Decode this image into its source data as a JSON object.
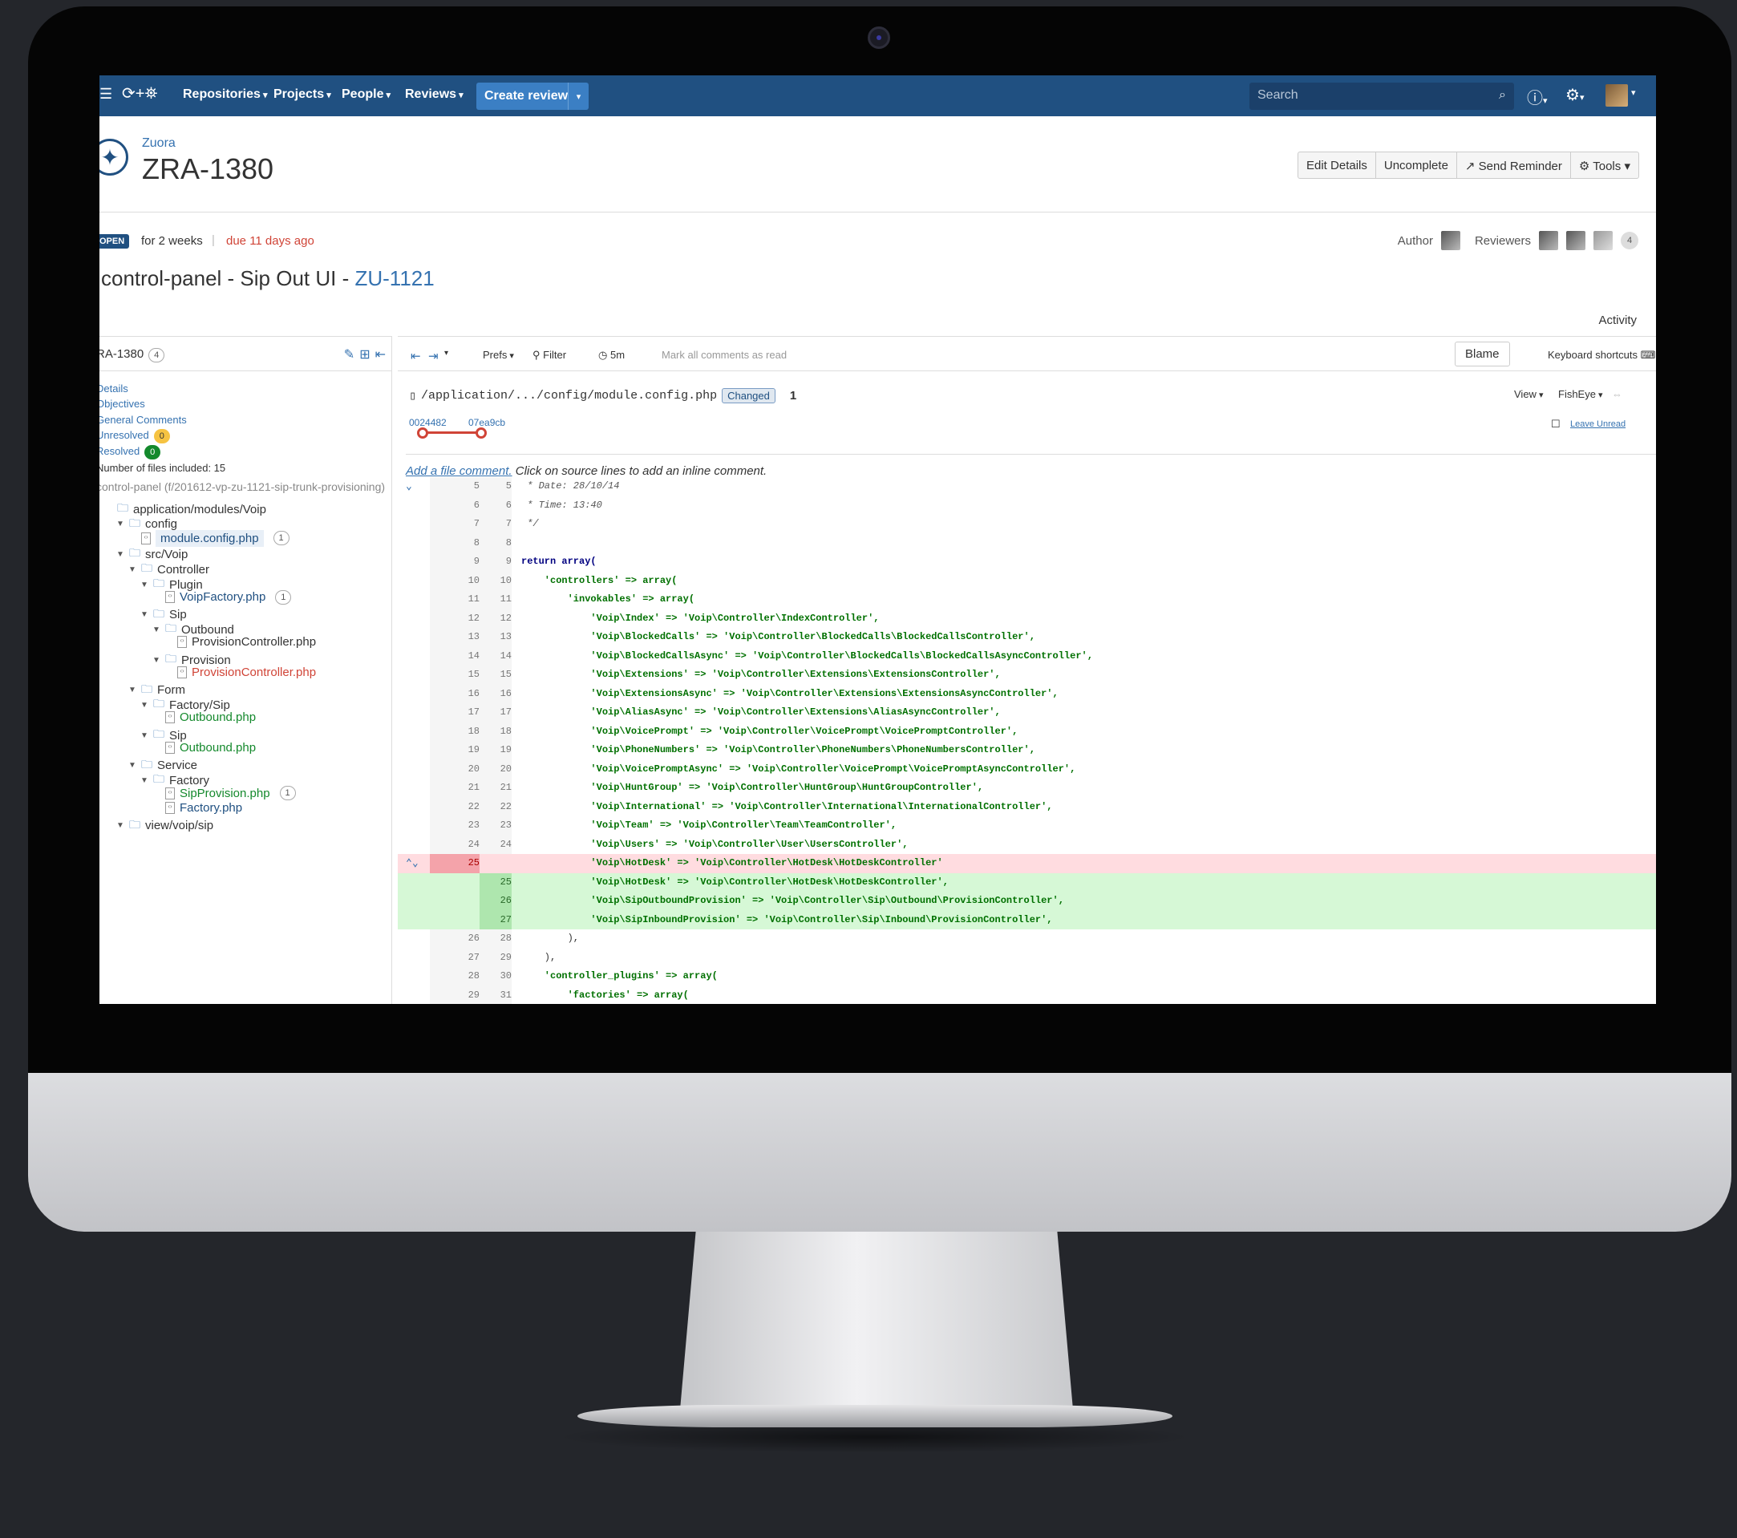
{
  "nav": {
    "menu_icon": "hamburger-icon",
    "logo_icon": "fisheye-crucible-logo",
    "items": [
      "Repositories",
      "Projects",
      "People",
      "Reviews"
    ],
    "create_label": "Create review",
    "search_placeholder": "Search",
    "accent": "#205081"
  },
  "header": {
    "project": "Zuora",
    "review_key": "ZRA-1380",
    "buttons": [
      "Edit Details",
      "Uncomplete",
      "Send Reminder",
      "Tools"
    ]
  },
  "status": {
    "state": "OPEN",
    "duration": "for 2 weeks",
    "due": "due 11 days ago",
    "author_label": "Author",
    "reviewers_label": "Reviewers",
    "reviewer_count": "4"
  },
  "review_title": "control-panel - Sip Out UI - ",
  "review_issue": "ZU-1121",
  "activity_label": "Activity",
  "left": {
    "id": "RA-1380",
    "id_count": "4",
    "links": [
      "Details",
      "Objectives",
      "General Comments",
      "Unresolved",
      "Resolved"
    ],
    "unresolved_count": "0",
    "resolved_count": "0",
    "files_included": "Number of files included: 15",
    "branch": "control-panel (f/201612-vp-zu-1121-sip-trunk-provisioning)",
    "tree": [
      {
        "label": "application/modules/Voip",
        "type": "folder",
        "depth": 0
      },
      {
        "label": "config",
        "type": "folder",
        "depth": 1
      },
      {
        "label": "module.config.php",
        "type": "file",
        "depth": 2,
        "count": "1",
        "color": "blue",
        "selected": true
      },
      {
        "label": "src/Voip",
        "type": "folder",
        "depth": 1
      },
      {
        "label": "Controller",
        "type": "folder",
        "depth": 2
      },
      {
        "label": "Plugin",
        "type": "folder",
        "depth": 3
      },
      {
        "label": "VoipFactory.php",
        "type": "file",
        "depth": 4,
        "count": "1",
        "color": "blue"
      },
      {
        "label": "Sip",
        "type": "folder",
        "depth": 3
      },
      {
        "label": "Outbound",
        "type": "folder",
        "depth": 4
      },
      {
        "label": "ProvisionController.php",
        "type": "file",
        "depth": 5,
        "color": "plain"
      },
      {
        "label": "Provision",
        "type": "folder",
        "depth": 4
      },
      {
        "label": "ProvisionController.php",
        "type": "file",
        "depth": 5,
        "color": "red"
      },
      {
        "label": "Form",
        "type": "folder",
        "depth": 2
      },
      {
        "label": "Factory/Sip",
        "type": "folder",
        "depth": 3
      },
      {
        "label": "Outbound.php",
        "type": "file",
        "depth": 4,
        "color": "green"
      },
      {
        "label": "Sip",
        "type": "folder",
        "depth": 3
      },
      {
        "label": "Outbound.php",
        "type": "file",
        "depth": 4,
        "color": "green"
      },
      {
        "label": "Service",
        "type": "folder",
        "depth": 2
      },
      {
        "label": "Factory",
        "type": "folder",
        "depth": 3
      },
      {
        "label": "SipProvision.php",
        "type": "file",
        "depth": 4,
        "count": "1",
        "color": "green"
      },
      {
        "label": "Factory.php",
        "type": "file",
        "depth": 4,
        "color": "blue"
      },
      {
        "label": "view/voip/sip",
        "type": "folder",
        "depth": 1
      }
    ]
  },
  "toolbar": {
    "prefs": "Prefs",
    "filter": "Filter",
    "refresh": "5m",
    "mark_read": "Mark all comments as read",
    "blame": "Blame",
    "shortcuts": "Keyboard shortcuts"
  },
  "file": {
    "path": "/application/.../config/module.config.php",
    "status": "Changed",
    "comment_count": "1",
    "rev_from": "0024482",
    "rev_to": "07ea9cb",
    "view": "View",
    "fisheye": "FishEye",
    "leave_unread": "Leave Unread",
    "add_comment_link": "Add a file comment.",
    "add_comment_hint": " Click on source lines to add an inline comment."
  },
  "diff": [
    {
      "o": "5",
      "n": "5",
      "code": " * Date: 28/10/14",
      "k": "cm",
      "mk": "⌄"
    },
    {
      "o": "6",
      "n": "6",
      "code": " * Time: 13:40",
      "k": "cm"
    },
    {
      "o": "7",
      "n": "7",
      "code": " */",
      "k": "cm"
    },
    {
      "o": "8",
      "n": "8",
      "code": "",
      "k": ""
    },
    {
      "o": "9",
      "n": "9",
      "code": "return array(",
      "k": "kw"
    },
    {
      "o": "10",
      "n": "10",
      "code": "    'controllers' => array(",
      "k": "str"
    },
    {
      "o": "11",
      "n": "11",
      "code": "        'invokables' => array(",
      "k": "str"
    },
    {
      "o": "12",
      "n": "12",
      "code": "            'Voip\\Index' => 'Voip\\Controller\\IndexController',",
      "k": "str"
    },
    {
      "o": "13",
      "n": "13",
      "code": "            'Voip\\BlockedCalls' => 'Voip\\Controller\\BlockedCalls\\BlockedCallsController',",
      "k": "str"
    },
    {
      "o": "14",
      "n": "14",
      "code": "            'Voip\\BlockedCallsAsync' => 'Voip\\Controller\\BlockedCalls\\BlockedCallsAsyncController',",
      "k": "str"
    },
    {
      "o": "15",
      "n": "15",
      "code": "            'Voip\\Extensions' => 'Voip\\Controller\\Extensions\\ExtensionsController',",
      "k": "str"
    },
    {
      "o": "16",
      "n": "16",
      "code": "            'Voip\\ExtensionsAsync' => 'Voip\\Controller\\Extensions\\ExtensionsAsyncController',",
      "k": "str"
    },
    {
      "o": "17",
      "n": "17",
      "code": "            'Voip\\AliasAsync' => 'Voip\\Controller\\Extensions\\AliasAsyncController',",
      "k": "str"
    },
    {
      "o": "18",
      "n": "18",
      "code": "            'Voip\\VoicePrompt' => 'Voip\\Controller\\VoicePrompt\\VoicePromptController',",
      "k": "str"
    },
    {
      "o": "19",
      "n": "19",
      "code": "            'Voip\\PhoneNumbers' => 'Voip\\Controller\\PhoneNumbers\\PhoneNumbersController',",
      "k": "str"
    },
    {
      "o": "20",
      "n": "20",
      "code": "            'Voip\\VoicePromptAsync' => 'Voip\\Controller\\VoicePrompt\\VoicePromptAsyncController',",
      "k": "str"
    },
    {
      "o": "21",
      "n": "21",
      "code": "            'Voip\\HuntGroup' => 'Voip\\Controller\\HuntGroup\\HuntGroupController',",
      "k": "str"
    },
    {
      "o": "22",
      "n": "22",
      "code": "            'Voip\\International' => 'Voip\\Controller\\International\\InternationalController',",
      "k": "str"
    },
    {
      "o": "23",
      "n": "23",
      "code": "            'Voip\\Team' => 'Voip\\Controller\\Team\\TeamController',",
      "k": "str"
    },
    {
      "o": "24",
      "n": "24",
      "code": "            'Voip\\Users' => 'Voip\\Controller\\User\\UsersController',",
      "k": "str"
    },
    {
      "o": "25",
      "n": "",
      "code": "            'Voip\\HotDesk' => 'Voip\\Controller\\HotDesk\\HotDeskController'",
      "k": "str",
      "t": "del",
      "mk": "⌃⌄"
    },
    {
      "o": "",
      "n": "25",
      "code": "            'Voip\\HotDesk' => 'Voip\\Controller\\HotDesk\\HotDeskController',",
      "k": "str",
      "t": "add"
    },
    {
      "o": "",
      "n": "26",
      "code": "            'Voip\\SipOutboundProvision' => 'Voip\\Controller\\Sip\\Outbound\\ProvisionController',",
      "k": "str",
      "t": "add"
    },
    {
      "o": "",
      "n": "27",
      "code": "            'Voip\\SipInboundProvision' => 'Voip\\Controller\\Sip\\Inbound\\ProvisionController',",
      "k": "str",
      "t": "add"
    },
    {
      "o": "26",
      "n": "28",
      "code": "        ),",
      "k": ""
    },
    {
      "o": "27",
      "n": "29",
      "code": "    ),",
      "k": ""
    },
    {
      "o": "28",
      "n": "30",
      "code": "    'controller_plugins' => array(",
      "k": "str"
    },
    {
      "o": "29",
      "n": "31",
      "code": "        'factories' => array(",
      "k": "str"
    }
  ]
}
